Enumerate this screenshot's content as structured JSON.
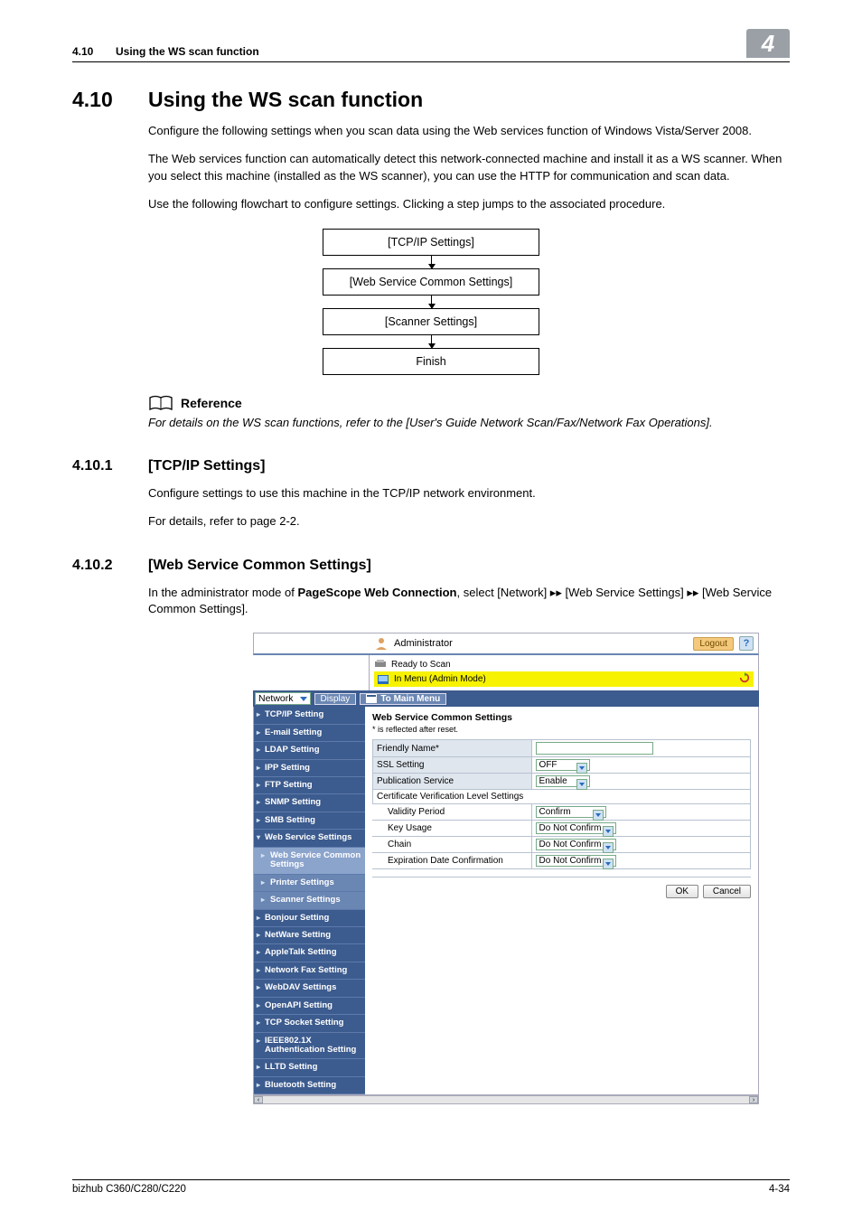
{
  "runhead": {
    "section_no": "4.10",
    "section_title": "Using the WS scan function",
    "chapter_no": "4"
  },
  "h1": {
    "num": "4.10",
    "title": "Using the WS scan function"
  },
  "intro_p1": "Configure the following settings when you scan data using the Web services function of Windows Vista/Server 2008.",
  "intro_p2": "The Web services function can automatically detect this network-connected machine and install it as a WS scanner. When you select this machine (installed as the WS scanner), you can use the HTTP for communication and scan data.",
  "intro_p3": "Use the following flowchart to configure settings. Clicking a step jumps to the associated procedure.",
  "flow": {
    "b1": "[TCP/IP Settings]",
    "b2": "[Web Service Common Settings]",
    "b3": "[Scanner Settings]",
    "b4": "Finish"
  },
  "reference": {
    "head": "Reference",
    "text": "For details on the WS scan functions, refer to the [User's Guide Network Scan/Fax/Network Fax Operations]."
  },
  "s1": {
    "num": "4.10.1",
    "title": "[TCP/IP Settings]",
    "p1": "Configure settings to use this machine in the TCP/IP network environment.",
    "p2": "For details, refer to page 2-2."
  },
  "s2": {
    "num": "4.10.2",
    "title": "[Web Service Common Settings]",
    "p1_a": "In the administrator mode of ",
    "p1_b": "PageScope Web Connection",
    "p1_c": ", select [Network] ▸▸ [Web Service Settings] ▸▸ [Web Service Common Settings]."
  },
  "shot": {
    "topbar": {
      "admin": "Administrator",
      "logout": "Logout",
      "help": "?"
    },
    "status": {
      "ready": "Ready to Scan",
      "mode": "In Menu (Admin Mode)"
    },
    "menubar": {
      "select": "Network",
      "display": "Display",
      "tomain": "To Main Menu"
    },
    "side": [
      "TCP/IP Setting",
      "E-mail Setting",
      "LDAP Setting",
      "IPP Setting",
      "FTP Setting",
      "SNMP Setting",
      "SMB Setting",
      "Web Service Settings",
      "Web Service Common Settings",
      "Printer Settings",
      "Scanner Settings",
      "Bonjour Setting",
      "NetWare Setting",
      "AppleTalk Setting",
      "Network Fax Setting",
      "WebDAV Settings",
      "OpenAPI Setting",
      "TCP Socket Setting",
      "IEEE802.1X Authentication Setting",
      "LLTD Setting",
      "Bluetooth Setting"
    ],
    "main": {
      "title": "Web Service Common Settings",
      "note": "* is reflected after reset.",
      "rows": {
        "friendly_name": "Friendly Name*",
        "ssl_setting": "SSL Setting",
        "ssl_val": "OFF",
        "pub_service": "Publication Service",
        "pub_val": "Enable",
        "cert_head": "Certificate Verification Level Settings",
        "validity": "Validity Period",
        "validity_val": "Confirm",
        "keyusage": "Key Usage",
        "keyusage_val": "Do Not Confirm",
        "chain": "Chain",
        "chain_val": "Do Not Confirm",
        "expdate": "Expiration Date Confirmation",
        "expdate_val": "Do Not Confirm"
      },
      "ok": "OK",
      "cancel": "Cancel"
    }
  },
  "footer": {
    "product": "bizhub C360/C280/C220",
    "page": "4-34"
  }
}
